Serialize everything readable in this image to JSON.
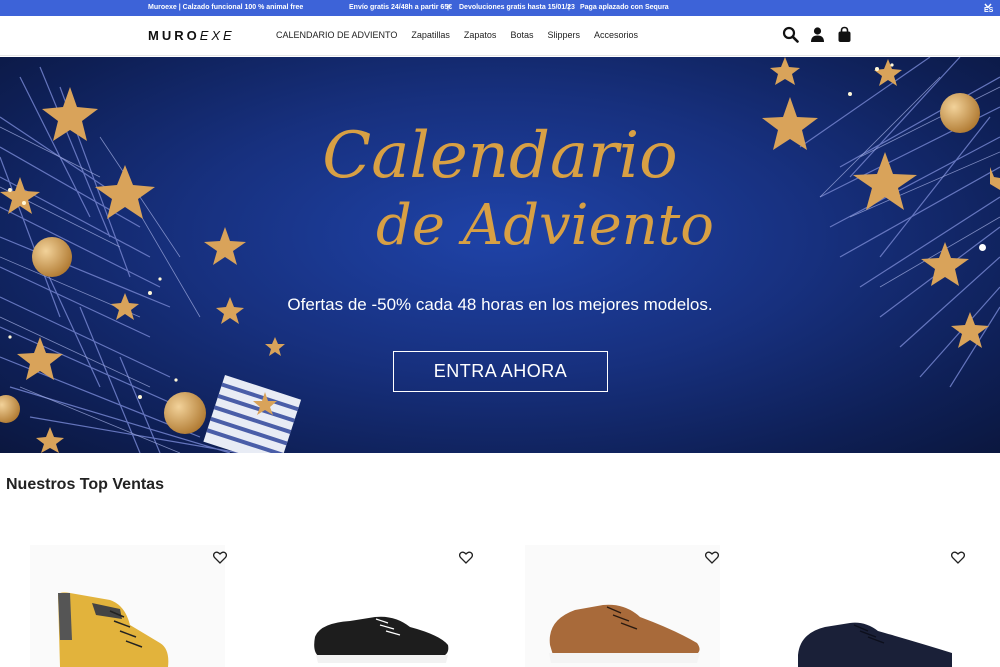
{
  "promo_bar": {
    "items": [
      "Muroexe | Calzado funcional 100 % animal free",
      "Envío gratis 24/48h a partir 65€",
      "|",
      "Devoluciones gratis hasta 15/01/23",
      "|",
      "Paga aplazado con Sequra"
    ],
    "lang": "ES",
    "color": "#3d63d8"
  },
  "header": {
    "logo_main": "MURO",
    "logo_accent": "EXE",
    "nav": [
      "CALENDARIO DE ADVIENTO",
      "Zapatillas",
      "Zapatos",
      "Botas",
      "Slippers",
      "Accesorios"
    ],
    "icons": [
      "search-icon",
      "account-icon",
      "bag-icon"
    ]
  },
  "hero": {
    "title_line1": "Calendario",
    "title_line2": "de Adviento",
    "subtitle": "Ofertas de -50% cada 48 horas en los mejores modelos.",
    "cta": "ENTRA AHORA",
    "title_color": "#d8a044"
  },
  "top_sales": {
    "heading": "Nuestros Top Ventas",
    "products": [
      {
        "name": "yellow-boot",
        "color": "#e0b03c"
      },
      {
        "name": "black-sneaker",
        "color": "#1b1b1b"
      },
      {
        "name": "brown-sneaker",
        "color": "#a86a3a"
      },
      {
        "name": "navy-sneaker",
        "color": "#1a2038"
      }
    ]
  }
}
